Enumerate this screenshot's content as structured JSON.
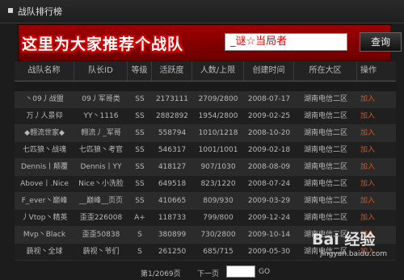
{
  "titlebar": {
    "title": "战队排行榜"
  },
  "banner": {
    "slogan": "这里为大家推荐个战队",
    "search_value": "_谜☆当局者",
    "search_button": "查询"
  },
  "table": {
    "headers": [
      "战队名称",
      "队长ID",
      "等级",
      "活跃度",
      "人数/上限",
      "创建时间",
      "所在大区",
      "操作"
    ],
    "rows": [
      [
        "丶09丿战盟",
        "09丿军哥类",
        "SS",
        "2173111",
        "2709/2800",
        "2008-07-17",
        "湖南电信二区",
        "加入"
      ],
      [
        "万丿人景仰",
        "YY丶1116",
        "SS",
        "2882892",
        "1954/2800",
        "2009-02-25",
        "湖南电信二区",
        "加入"
      ],
      [
        "◆翱流世家◆",
        "翱流丿_军哥",
        "SS",
        "558794",
        "1010/1218",
        "2008-10-20",
        "湖南电信二区",
        "加入"
      ],
      [
        "七匹狼丶战魂",
        "七匹狼丶考官",
        "SS",
        "546317",
        "1001/1001",
        "2009-02-18",
        "湖南电信二区",
        "加入"
      ],
      [
        "Dennis丨颠覆",
        "Dennis丨YY",
        "SS",
        "418127",
        "907/1030",
        "2008-08-09",
        "湖南电信二区",
        "加入"
      ],
      [
        "Above丨.Nice",
        "Nice丶小洗脸",
        "SS",
        "649518",
        "823/1220",
        "2008-07-24",
        "湖南电信二区",
        "加入"
      ],
      [
        "F_ever丶巅峰",
        "__巅峰__页页",
        "SS",
        "410665",
        "809/930",
        "2009-03-29",
        "湖南电信二区",
        "加入"
      ],
      [
        "丿Vtop丶精英",
        "歪歪226008",
        "A+",
        "118733",
        "799/800",
        "2009-12-24",
        "湖南电信二区",
        "加入"
      ],
      [
        "Mvp丶Black",
        "歪歪50838",
        "S",
        "380899",
        "730/2800",
        "2009-10-14",
        "湖南电信二区",
        "加入"
      ],
      [
        "藐视丶全球",
        "藐视丶爷们",
        "S",
        "261250",
        "685/715",
        "2009-05-30",
        "湖南电信二区",
        "加入"
      ]
    ]
  },
  "pager": {
    "page_info": "第1/2069页",
    "next": "下一页",
    "go": "GO"
  },
  "watermark": {
    "logo": "Bai 经验",
    "site": "jingyan.baidu.com"
  }
}
